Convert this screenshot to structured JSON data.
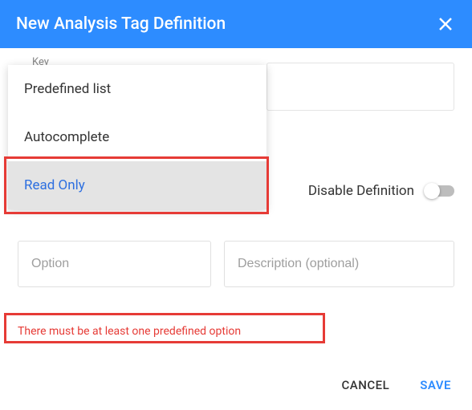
{
  "header": {
    "title": "New Analysis Tag Definition"
  },
  "key": {
    "label": "Key"
  },
  "dropdown": {
    "options": [
      "Predefined list",
      "Autocomplete",
      "Read Only"
    ],
    "highlighted_index": 2
  },
  "disable": {
    "label": "Disable Definition",
    "value": false
  },
  "option_field": {
    "placeholder": "Option",
    "value": ""
  },
  "description_field": {
    "placeholder": "Description (optional)",
    "value": ""
  },
  "error": {
    "msg": "There must be at least one predefined option"
  },
  "footer": {
    "cancel": "CANCEL",
    "save": "SAVE"
  }
}
